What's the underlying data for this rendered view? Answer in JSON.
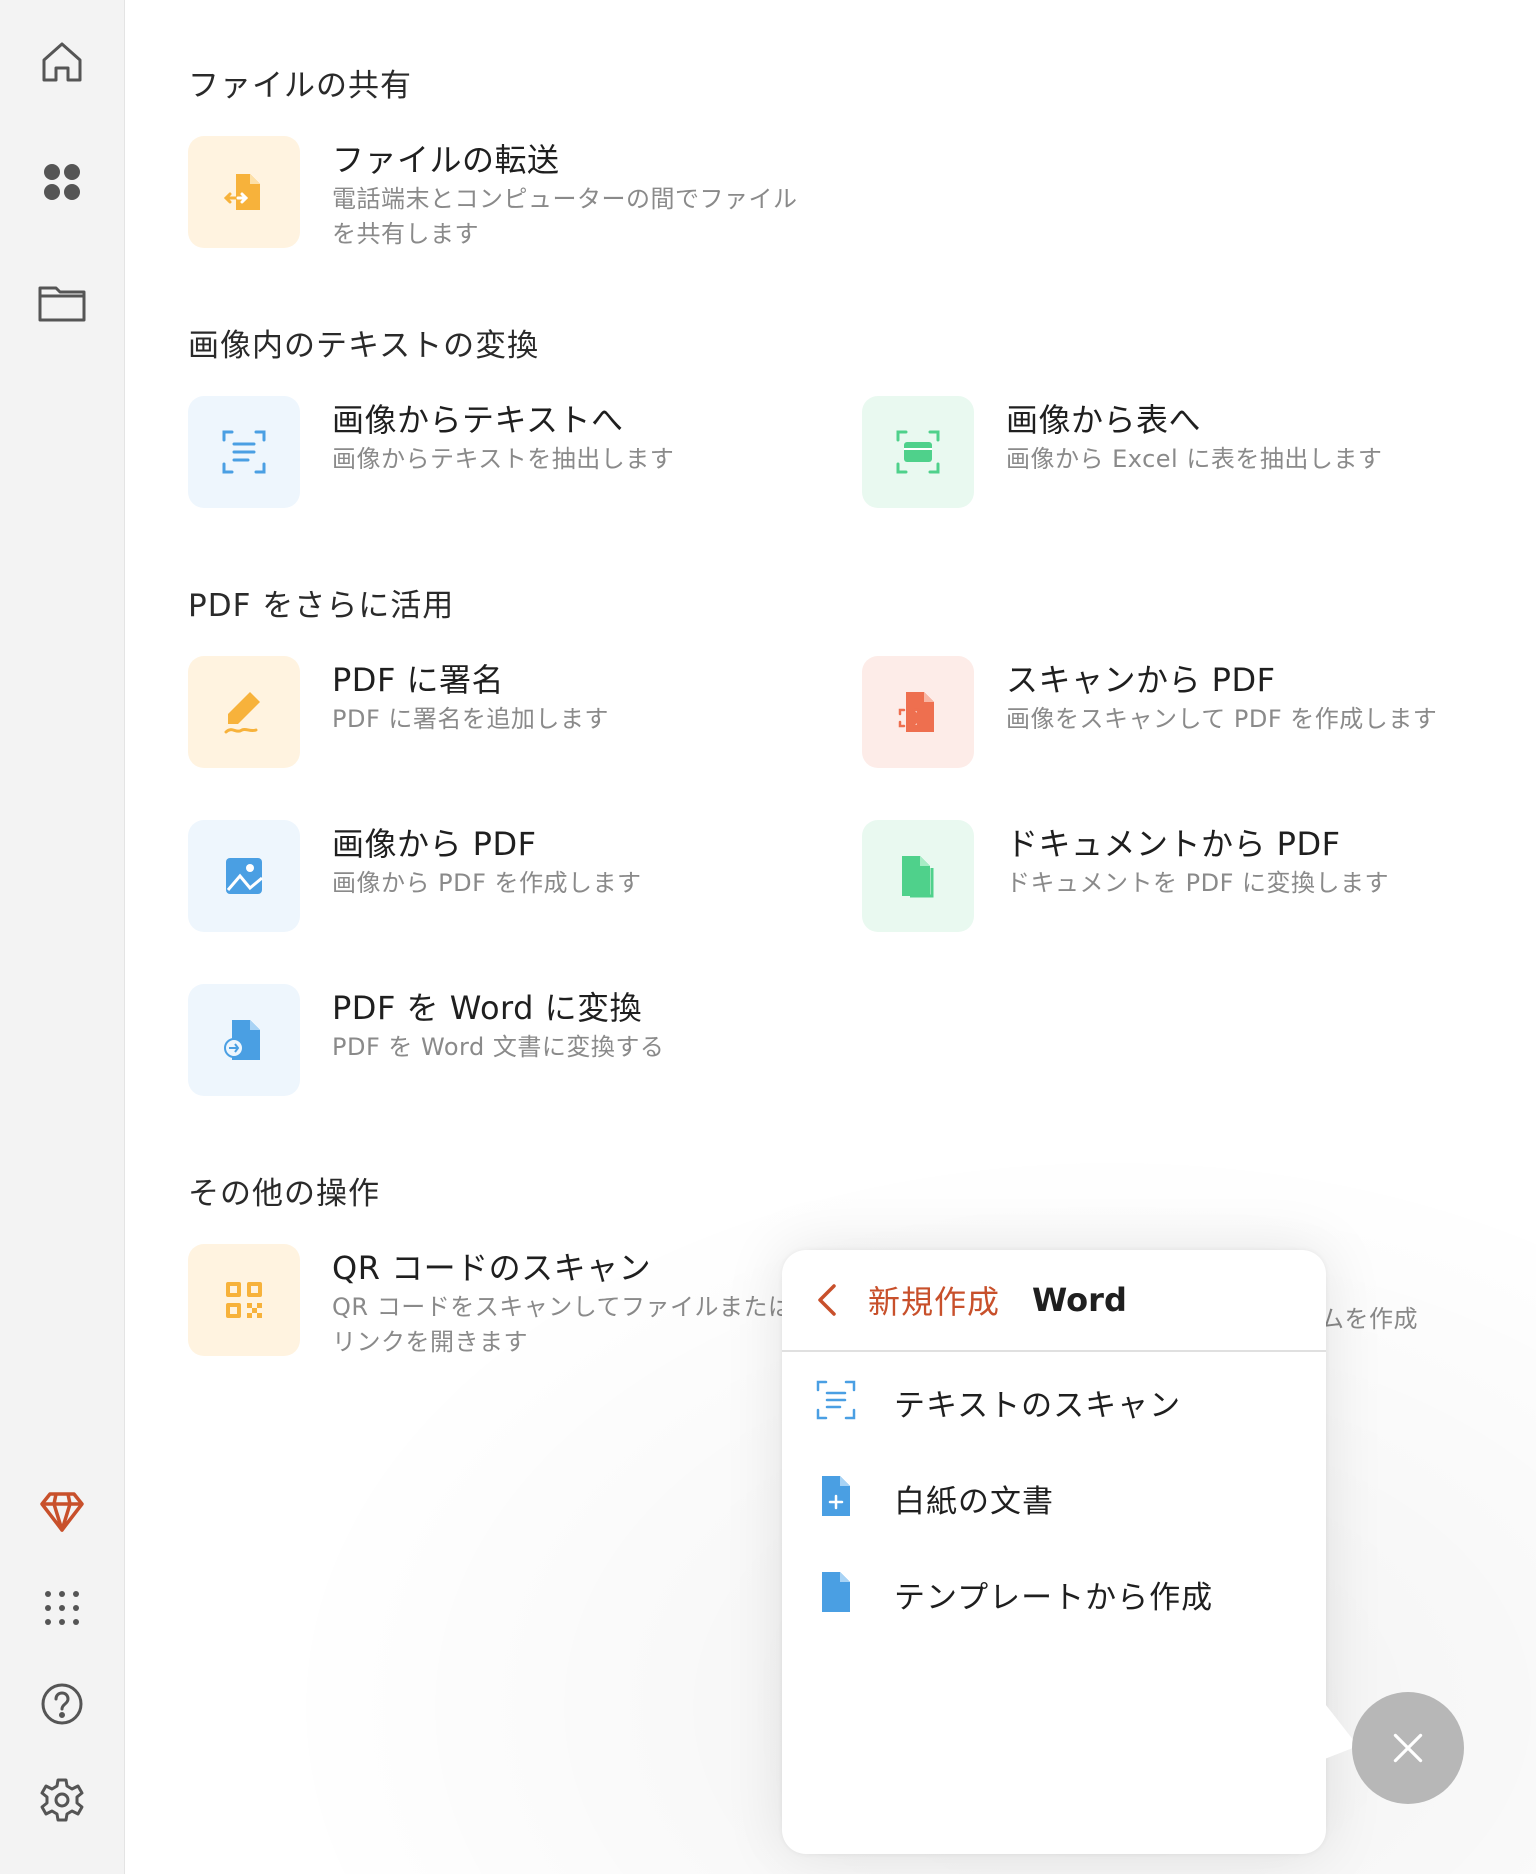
{
  "sidebar": {
    "items": [
      {
        "name": "home-icon"
      },
      {
        "name": "apps-icon"
      },
      {
        "name": "folder-icon"
      },
      {
        "name": "premium-diamond-icon"
      },
      {
        "name": "more-grid-icon"
      },
      {
        "name": "help-icon"
      },
      {
        "name": "settings-icon"
      }
    ]
  },
  "sections": {
    "share": {
      "title": "ファイルの共有",
      "transfer": {
        "title": "ファイルの転送",
        "desc1": "電話端末とコンピューターの間でファイル",
        "desc2": "を共有します",
        "icon": "file-transfer-icon"
      }
    },
    "image_text": {
      "title": "画像内のテキストの変換",
      "to_text": {
        "title": "画像からテキストへ",
        "desc": "画像からテキストを抽出します",
        "icon": "scan-text-icon"
      },
      "to_table": {
        "title": "画像から表へ",
        "desc": "画像から Excel に表を抽出します",
        "icon": "scan-table-icon"
      }
    },
    "pdf": {
      "title": "PDF をさらに活用",
      "sign": {
        "title": "PDF に署名",
        "desc": "PDF に署名を追加します",
        "icon": "signature-icon"
      },
      "scan_pdf": {
        "title": "スキャンから PDF",
        "desc": "画像をスキャンして PDF を作成します",
        "icon": "scan-pdf-icon"
      },
      "image_pdf": {
        "title": "画像から PDF",
        "desc": "画像から PDF を作成します",
        "icon": "image-icon"
      },
      "doc_pdf": {
        "title": "ドキュメントから PDF",
        "desc": "ドキュメントを PDF に変換します",
        "icon": "document-icon"
      },
      "pdf_word": {
        "title": "PDF を Word に変換",
        "desc": "PDF を Word 文書に変換する",
        "icon": "convert-icon"
      }
    },
    "other": {
      "title": "その他の操作",
      "qr": {
        "title": "QR コードのスキャン",
        "desc1": "QR コードをスキャンしてファイルまたは",
        "desc2": "リンクを開きます",
        "icon": "qr-code-icon"
      },
      "hidden_desc": "ムを作成"
    }
  },
  "popup": {
    "breadcrumb_parent": "新規作成",
    "breadcrumb_current": "Word",
    "items": [
      {
        "label": "テキストのスキャン",
        "icon": "scan-text-icon"
      },
      {
        "label": "白紙の文書",
        "icon": "new-document-icon"
      },
      {
        "label": "テンプレートから作成",
        "icon": "template-icon"
      }
    ]
  },
  "colors": {
    "accent": "#c8502b",
    "yellow": "#f7b23b",
    "blue": "#4a9fe3",
    "green": "#4fd18b",
    "red": "#ee6f4f"
  }
}
